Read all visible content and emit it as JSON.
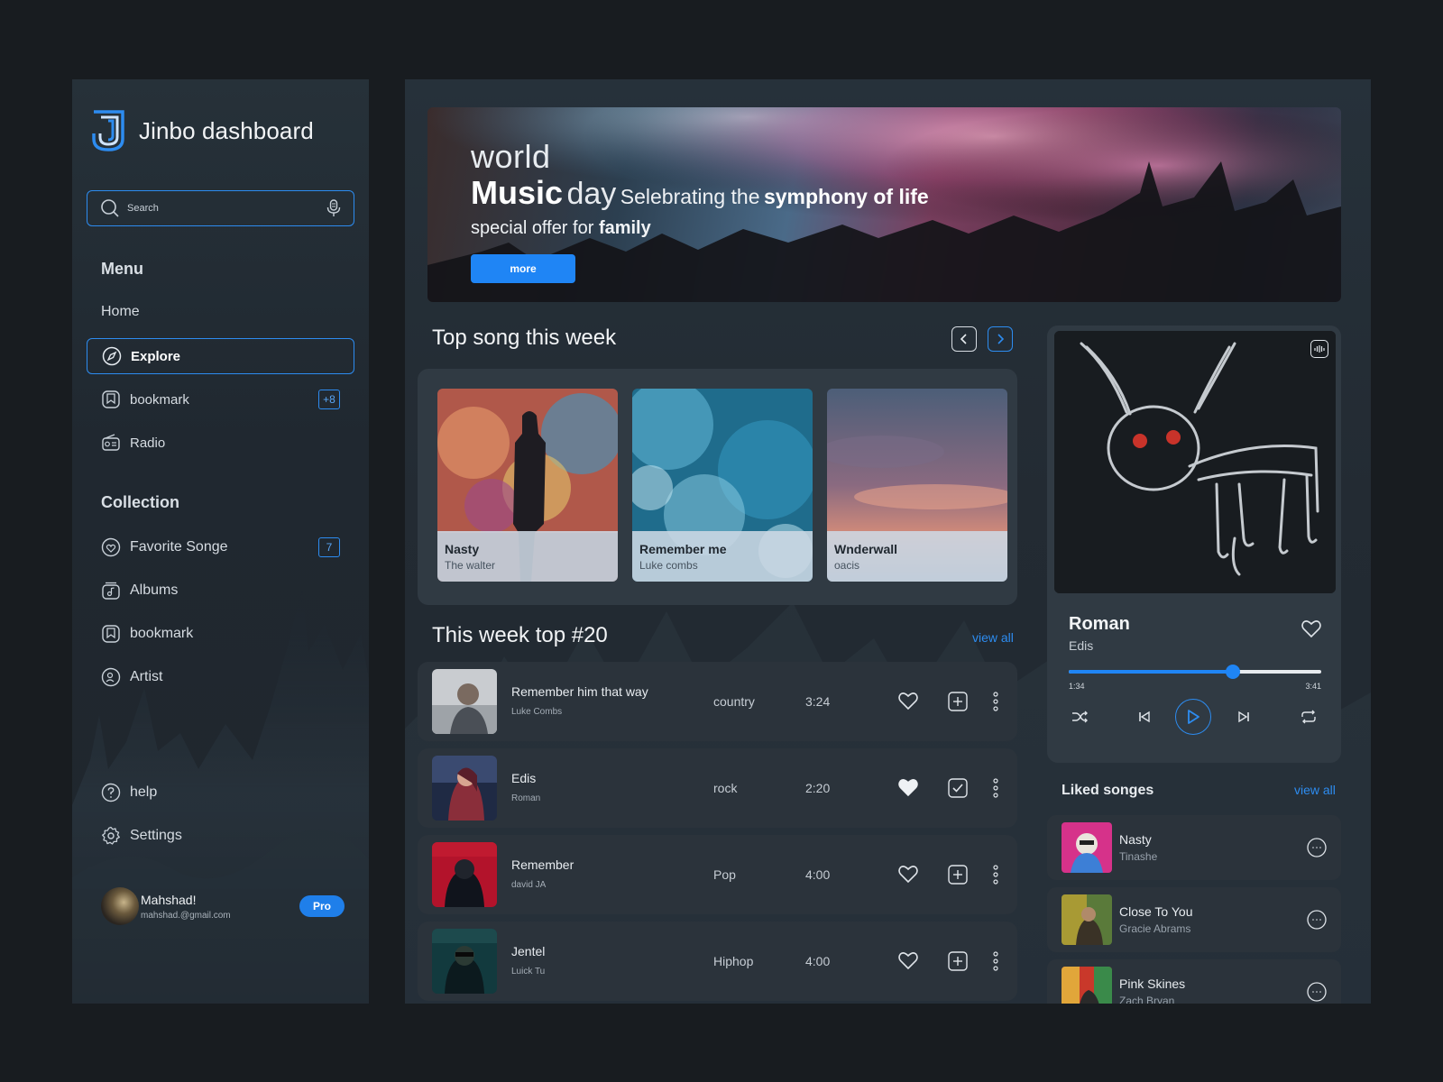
{
  "app": {
    "title": "Jinbo dashboard"
  },
  "search": {
    "placeholder": "Search"
  },
  "menu": {
    "heading": "Menu",
    "items": [
      {
        "label": "Home",
        "icon": "home"
      },
      {
        "label": "Explore",
        "icon": "compass-icon",
        "active": true
      },
      {
        "label": "bookmark",
        "icon": "bookmark-icon",
        "count": "+8"
      },
      {
        "label": "Radio",
        "icon": "radio-icon"
      }
    ]
  },
  "collection": {
    "heading": "Collection",
    "items": [
      {
        "label": "Favorite Songe",
        "icon": "heart-disc-icon",
        "count": "7"
      },
      {
        "label": "Albums",
        "icon": "album-icon"
      },
      {
        "label": "bookmark",
        "icon": "bookmark-icon"
      },
      {
        "label": "Artist",
        "icon": "artist-icon"
      }
    ]
  },
  "footer_nav": [
    {
      "label": "help",
      "icon": "help-icon"
    },
    {
      "label": "Settings",
      "icon": "gear-icon"
    }
  ],
  "user": {
    "name": "Mahshad!",
    "email": "mahshad.@gmail.com",
    "badge": "Pro"
  },
  "banner": {
    "line1": "world",
    "music": "Music",
    "day": "day",
    "tag_prefix": "Selebrating the",
    "tag_bold": "symphony of life",
    "offer_prefix": "special offer for",
    "offer_bold": "family",
    "button": "more"
  },
  "top_song": {
    "heading": "Top song this week",
    "cards": [
      {
        "title": "Nasty",
        "artist": "The walter"
      },
      {
        "title": "Remember me",
        "artist": "Luke combs"
      },
      {
        "title": "Wnderwall",
        "artist": "oacis"
      }
    ]
  },
  "weekly": {
    "heading": "This week top #20",
    "view_all": "view all",
    "rows": [
      {
        "title": "Remember him that way",
        "artist": "Luke Combs",
        "genre": "country",
        "duration": "3:24",
        "liked": false,
        "added": false
      },
      {
        "title": "Edis",
        "artist": "Roman",
        "genre": "rock",
        "duration": "2:20",
        "liked": true,
        "added": true
      },
      {
        "title": "Remember",
        "artist": "david JA",
        "genre": "Pop",
        "duration": "4:00",
        "liked": false,
        "added": false
      },
      {
        "title": "Jentel",
        "artist": "Luick Tu",
        "genre": "Hiphop",
        "duration": "4:00",
        "liked": false,
        "added": false
      }
    ]
  },
  "player": {
    "title": "Roman",
    "artist": "Edis",
    "current": "1:34",
    "total": "3:41",
    "progress": 0.65
  },
  "liked": {
    "heading": "Liked songes",
    "view_all": "view all",
    "items": [
      {
        "title": "Nasty",
        "artist": "Tinashe"
      },
      {
        "title": "Close To You",
        "artist": "Gracie Abrams"
      },
      {
        "title": "Pink Skines",
        "artist": "Zach Bryan"
      }
    ]
  },
  "colors": {
    "accent": "#1f85f5",
    "background": "#181c20",
    "panel": "#303a43"
  }
}
